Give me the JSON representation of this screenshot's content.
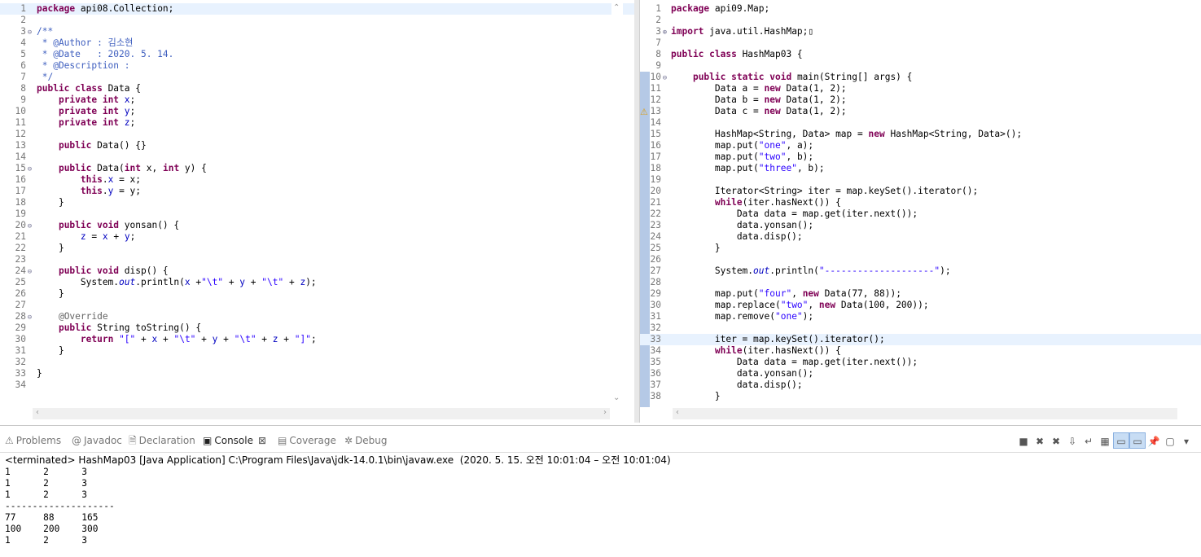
{
  "left_editor": {
    "lines": [
      {
        "n": "1",
        "fold": "",
        "code": "<span class=\"kw\">package</span> api08.Collection;"
      },
      {
        "n": "2",
        "fold": "",
        "code": ""
      },
      {
        "n": "3",
        "fold": "⊖",
        "code": "<span class=\"cm\">/**</span>"
      },
      {
        "n": "4",
        "fold": "",
        "code": "<span class=\"cm\"> * @Author : 김소현</span>"
      },
      {
        "n": "5",
        "fold": "",
        "code": "<span class=\"cm\"> * @Date   : 2020. 5. 14.</span>"
      },
      {
        "n": "6",
        "fold": "",
        "code": "<span class=\"cm\"> * @Description :</span>"
      },
      {
        "n": "7",
        "fold": "",
        "code": "<span class=\"cm\"> */</span>"
      },
      {
        "n": "8",
        "fold": "",
        "code": "<span class=\"kw\">public class</span> Data {"
      },
      {
        "n": "9",
        "fold": "",
        "code": "    <span class=\"kw\">private int</span> <span class=\"fld\">x</span>;"
      },
      {
        "n": "10",
        "fold": "",
        "code": "    <span class=\"kw\">private int</span> <span class=\"fld\">y</span>;"
      },
      {
        "n": "11",
        "fold": "",
        "code": "    <span class=\"kw\">private int</span> <span class=\"fld\">z</span>;"
      },
      {
        "n": "12",
        "fold": "",
        "code": ""
      },
      {
        "n": "13",
        "fold": "",
        "code": "    <span class=\"kw\">public</span> Data() {}"
      },
      {
        "n": "14",
        "fold": "",
        "code": ""
      },
      {
        "n": "15",
        "fold": "⊖",
        "code": "    <span class=\"kw\">public</span> Data(<span class=\"kw\">int</span> x, <span class=\"kw\">int</span> y) {"
      },
      {
        "n": "16",
        "fold": "",
        "code": "        <span class=\"kw\">this</span>.<span class=\"fld\">x</span> = x;"
      },
      {
        "n": "17",
        "fold": "",
        "code": "        <span class=\"kw\">this</span>.<span class=\"fld\">y</span> = y;"
      },
      {
        "n": "18",
        "fold": "",
        "code": "    }"
      },
      {
        "n": "19",
        "fold": "",
        "code": ""
      },
      {
        "n": "20",
        "fold": "⊖",
        "code": "    <span class=\"kw\">public void</span> yonsan() {"
      },
      {
        "n": "21",
        "fold": "",
        "code": "        <span class=\"fld\">z</span> = <span class=\"fld\">x</span> + <span class=\"fld\">y</span>;"
      },
      {
        "n": "22",
        "fold": "",
        "code": "    }"
      },
      {
        "n": "23",
        "fold": "",
        "code": ""
      },
      {
        "n": "24",
        "fold": "⊖",
        "code": "    <span class=\"kw\">public void</span> disp() {"
      },
      {
        "n": "25",
        "fold": "",
        "code": "        System.<span class=\"stat\">out</span>.println(<span class=\"fld\">x</span> +<span class=\"str\">\"\\t\"</span> + <span class=\"fld\">y</span> + <span class=\"str\">\"\\t\"</span> + <span class=\"fld\">z</span>);"
      },
      {
        "n": "26",
        "fold": "",
        "code": "    }"
      },
      {
        "n": "27",
        "fold": "",
        "code": ""
      },
      {
        "n": "28",
        "fold": "⊖",
        "code": "    <span class=\"ann\">@Override</span>"
      },
      {
        "n": "29",
        "fold": "",
        "code": "    <span class=\"kw\">public</span> String toString() {"
      },
      {
        "n": "30",
        "fold": "",
        "code": "        <span class=\"kw\">return</span> <span class=\"str\">\"[\"</span> + <span class=\"fld\">x</span> + <span class=\"str\">\"\\t\"</span> + <span class=\"fld\">y</span> + <span class=\"str\">\"\\t\"</span> + <span class=\"fld\">z</span> + <span class=\"str\">\"]\"</span>;"
      },
      {
        "n": "31",
        "fold": "",
        "code": "    }"
      },
      {
        "n": "32",
        "fold": "",
        "code": ""
      },
      {
        "n": "33",
        "fold": "",
        "code": "}"
      },
      {
        "n": "34",
        "fold": "",
        "code": ""
      }
    ]
  },
  "right_editor": {
    "lines": [
      {
        "n": "1",
        "fold": "",
        "code": "<span class=\"kw\">package</span> api09.Map;"
      },
      {
        "n": "2",
        "fold": "",
        "code": ""
      },
      {
        "n": "3",
        "fold": "⊕",
        "code": "<span class=\"kw\">import</span> java.util.HashMap;▯"
      },
      {
        "n": "7",
        "fold": "",
        "code": ""
      },
      {
        "n": "8",
        "fold": "",
        "code": "<span class=\"kw\">public class</span> HashMap03 {"
      },
      {
        "n": "9",
        "fold": "",
        "code": ""
      },
      {
        "n": "10",
        "fold": "⊖",
        "code": "    <span class=\"kw\">public static void</span> main(String[] args) {"
      },
      {
        "n": "11",
        "fold": "",
        "code": "        Data a = <span class=\"kw\">new</span> Data(1, 2);"
      },
      {
        "n": "12",
        "fold": "",
        "code": "        Data b = <span class=\"kw\">new</span> Data(1, 2);"
      },
      {
        "n": "13",
        "fold": "",
        "code": "        Data c = <span class=\"kw\">new</span> Data(1, 2);"
      },
      {
        "n": "14",
        "fold": "",
        "code": ""
      },
      {
        "n": "15",
        "fold": "",
        "code": "        HashMap&lt;String, Data&gt; map = <span class=\"kw\">new</span> HashMap&lt;String, Data&gt;();"
      },
      {
        "n": "16",
        "fold": "",
        "code": "        map.put(<span class=\"str\">\"one\"</span>, a);"
      },
      {
        "n": "17",
        "fold": "",
        "code": "        map.put(<span class=\"str\">\"two\"</span>, b);"
      },
      {
        "n": "18",
        "fold": "",
        "code": "        map.put(<span class=\"str\">\"three\"</span>, b);"
      },
      {
        "n": "19",
        "fold": "",
        "code": ""
      },
      {
        "n": "20",
        "fold": "",
        "code": "        Iterator&lt;String&gt; iter = map.keySet().iterator();"
      },
      {
        "n": "21",
        "fold": "",
        "code": "        <span class=\"kw\">while</span>(iter.hasNext()) {"
      },
      {
        "n": "22",
        "fold": "",
        "code": "            Data data = map.get(iter.next());"
      },
      {
        "n": "23",
        "fold": "",
        "code": "            data.yonsan();"
      },
      {
        "n": "24",
        "fold": "",
        "code": "            data.disp();"
      },
      {
        "n": "25",
        "fold": "",
        "code": "        }"
      },
      {
        "n": "26",
        "fold": "",
        "code": ""
      },
      {
        "n": "27",
        "fold": "",
        "code": "        System.<span class=\"stat\">out</span>.println(<span class=\"str\">\"--------------------\"</span>);"
      },
      {
        "n": "28",
        "fold": "",
        "code": ""
      },
      {
        "n": "29",
        "fold": "",
        "code": "        map.put(<span class=\"str\">\"four\"</span>, <span class=\"kw\">new</span> Data(77, 88));"
      },
      {
        "n": "30",
        "fold": "",
        "code": "        map.replace(<span class=\"str\">\"two\"</span>, <span class=\"kw\">new</span> Data(100, 200));"
      },
      {
        "n": "31",
        "fold": "",
        "code": "        map.remove(<span class=\"str\">\"one\"</span>);"
      },
      {
        "n": "32",
        "fold": "",
        "code": ""
      },
      {
        "n": "33",
        "fold": "",
        "code": "        iter = map.keySet().iterator();"
      },
      {
        "n": "34",
        "fold": "",
        "code": "        <span class=\"kw\">while</span>(iter.hasNext()) {"
      },
      {
        "n": "35",
        "fold": "",
        "code": "            Data data = map.get(iter.next());"
      },
      {
        "n": "36",
        "fold": "",
        "code": "            data.yonsan();"
      },
      {
        "n": "37",
        "fold": "",
        "code": "            data.disp();"
      },
      {
        "n": "38",
        "fold": "",
        "code": "        }"
      }
    ]
  },
  "console": {
    "tabs": [
      {
        "label": "Problems",
        "icon": "problems-icon",
        "glyph": "⚠"
      },
      {
        "label": "Javadoc",
        "icon": "javadoc-icon",
        "glyph": "@"
      },
      {
        "label": "Declaration",
        "icon": "declaration-icon",
        "glyph": "🗎"
      },
      {
        "label": "Console",
        "icon": "console-icon",
        "glyph": "▣",
        "active": true
      },
      {
        "label": "Coverage",
        "icon": "coverage-icon",
        "glyph": "▤"
      },
      {
        "label": "Debug",
        "icon": "debug-icon",
        "glyph": "✲"
      }
    ],
    "terminated": "<terminated> HashMap03 [Java Application] C:\\Program Files\\Java\\jdk-14.0.1\\bin\\javaw.exe  (2020. 5. 15. 오전 10:01:04 – 오전 10:01:04)",
    "output": [
      "1\t2\t3",
      "1\t2\t3",
      "1\t2\t3",
      "--------------------",
      "77\t88\t165",
      "100\t200\t300",
      "1\t2\t3"
    ],
    "toolbar": [
      {
        "icon": "terminate-icon",
        "glyph": "■"
      },
      {
        "icon": "remove-launch-icon",
        "glyph": "✖"
      },
      {
        "icon": "remove-all-icon",
        "glyph": "✖"
      },
      {
        "icon": "scroll-lock-icon",
        "glyph": "⇩"
      },
      {
        "icon": "word-wrap-icon",
        "glyph": "↵"
      },
      {
        "icon": "clear-console-icon",
        "glyph": "▦"
      },
      {
        "icon": "show-console-stdout-icon",
        "glyph": "▭",
        "on": true
      },
      {
        "icon": "show-console-stderr-icon",
        "glyph": "▭",
        "on": true
      },
      {
        "icon": "pin-console-icon",
        "glyph": "📌"
      },
      {
        "icon": "display-console-icon",
        "glyph": "▢"
      },
      {
        "icon": "view-menu-icon",
        "glyph": "▾"
      }
    ]
  }
}
